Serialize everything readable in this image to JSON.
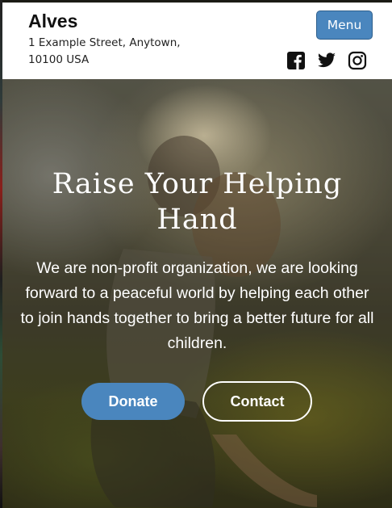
{
  "header": {
    "brand": "Alves",
    "address": "1 Example Street, Anytown, 10100 USA",
    "menu_label": "Menu",
    "socials": [
      {
        "name": "facebook-icon"
      },
      {
        "name": "twitter-icon"
      },
      {
        "name": "instagram-icon"
      }
    ]
  },
  "hero": {
    "title": "Raise Your Helping Hand",
    "text": "We are non-profit organization, we are looking forward to a peaceful world by helping each other to join hands together to bring a better future for all children.",
    "donate_label": "Donate",
    "contact_label": "Contact"
  },
  "colors": {
    "accent": "#4a86be",
    "header_bg": "#ffffff",
    "hero_text": "#ffffff"
  }
}
